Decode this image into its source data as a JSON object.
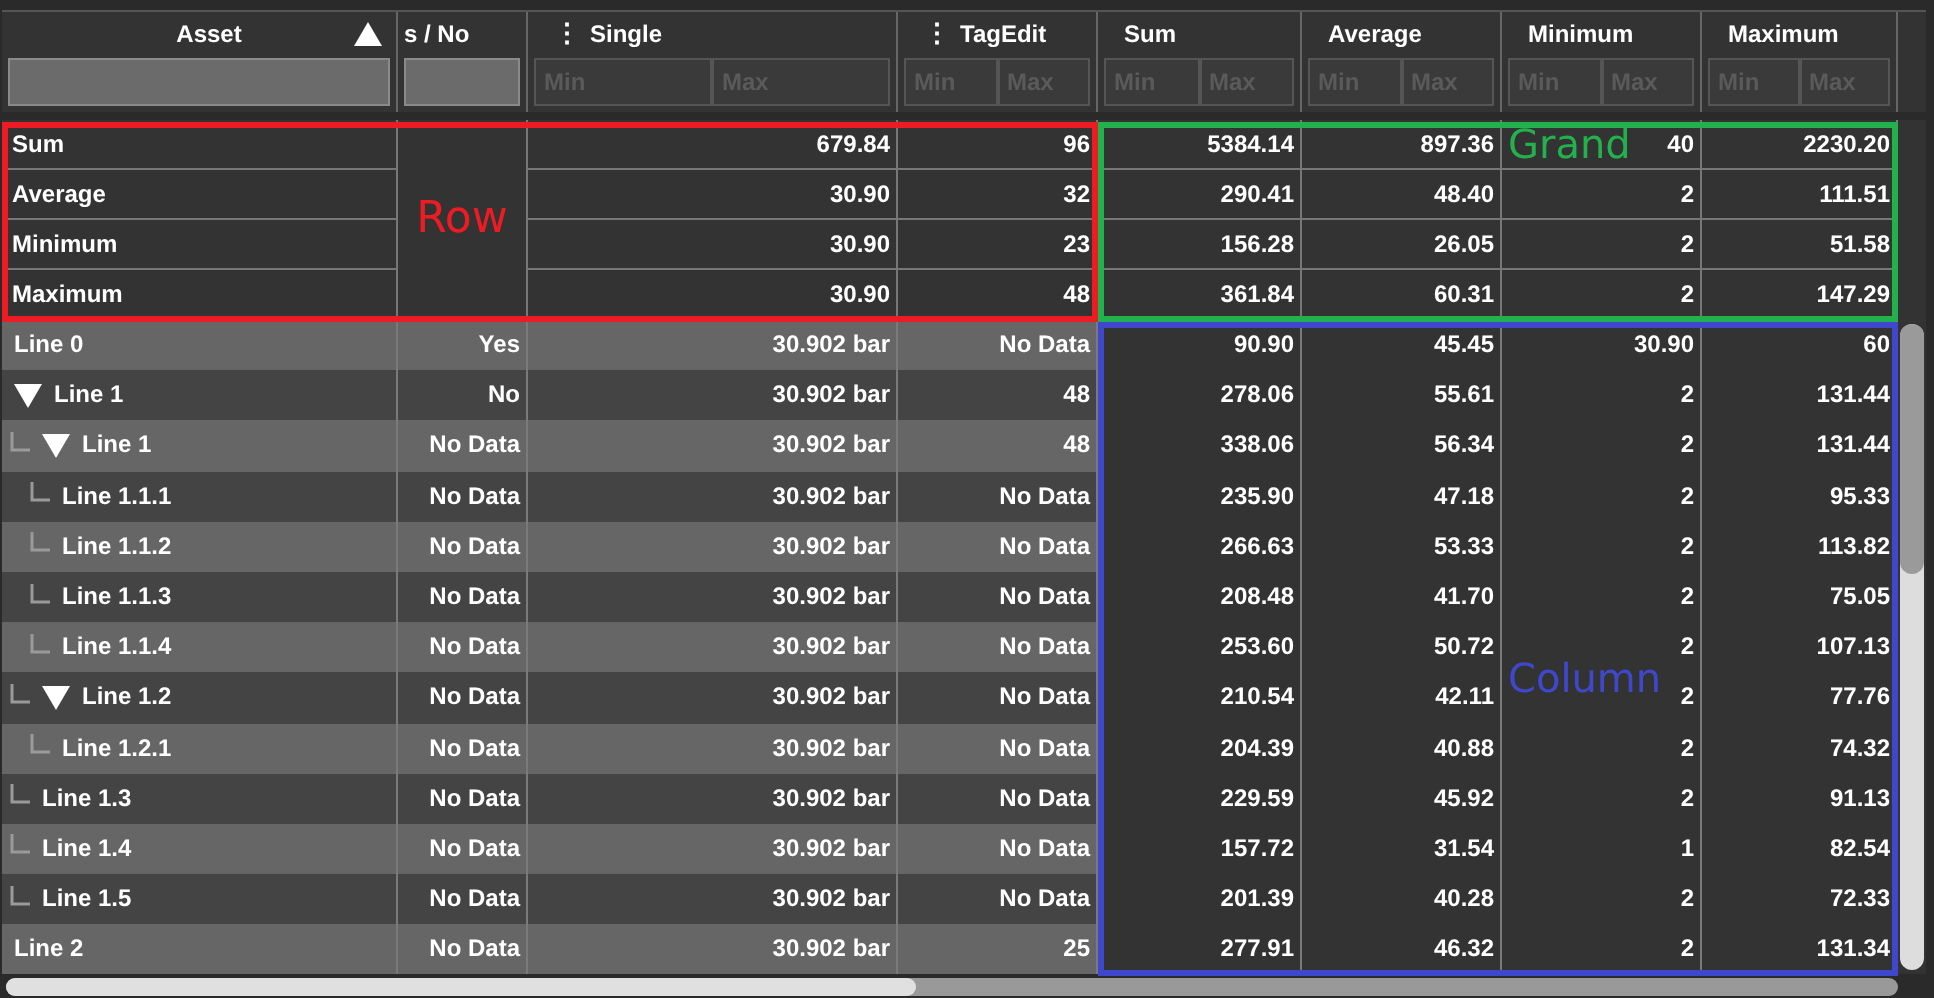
{
  "table": {
    "columns": [
      {
        "title": "Asset",
        "sorted_ascending": true,
        "kind": "text",
        "striped": true
      },
      {
        "title": "s / No",
        "kind": "text",
        "striped": true
      },
      {
        "title": "Single",
        "menu_glyph": "⋮",
        "kind": "range",
        "min_placeholder": "Min",
        "max_placeholder": "Max",
        "striped": true
      },
      {
        "title": "TagEdit",
        "menu_glyph": "⋮",
        "kind": "range",
        "min_placeholder": "Min",
        "max_placeholder": "Max",
        "striped": true
      },
      {
        "title": "Sum",
        "kind": "range",
        "min_placeholder": "Min",
        "max_placeholder": "Max",
        "striped": false
      },
      {
        "title": "Average",
        "kind": "range",
        "min_placeholder": "Min",
        "max_placeholder": "Max",
        "striped": false
      },
      {
        "title": "Minimum",
        "kind": "range",
        "min_placeholder": "Min",
        "max_placeholder": "Max",
        "striped": false
      },
      {
        "title": "Maximum",
        "kind": "range",
        "min_placeholder": "Min",
        "max_placeholder": "Max",
        "striped": false
      }
    ],
    "totals": [
      {
        "label": "Sum",
        "cells": [
          null,
          "679.84",
          "96",
          "5384.14",
          "897.36",
          "40",
          "2230.20"
        ]
      },
      {
        "label": "Average",
        "cells": [
          null,
          "30.90",
          "32",
          "290.41",
          "48.40",
          "2",
          "111.51"
        ]
      },
      {
        "label": "Minimum",
        "cells": [
          null,
          "30.90",
          "23",
          "156.28",
          "26.05",
          "2",
          "51.58"
        ]
      },
      {
        "label": "Maximum",
        "cells": [
          null,
          "30.90",
          "48",
          "361.84",
          "60.31",
          "2",
          "147.29"
        ]
      }
    ],
    "rows": [
      {
        "label": "Line 0",
        "cells": [
          "Yes",
          "30.902 bar",
          "No Data",
          "90.90",
          "45.45",
          "30.90",
          "60"
        ]
      },
      {
        "label": "Line 1",
        "expanded": true,
        "cells": [
          "No",
          "30.902 bar",
          "48",
          "278.06",
          "55.61",
          "2",
          "131.44"
        ],
        "children": [
          {
            "label": "Line 1",
            "expanded": true,
            "cells": [
              "No Data",
              "30.902 bar",
              "48",
              "338.06",
              "56.34",
              "2",
              "131.44"
            ],
            "children": [
              {
                "label": "Line 1.1.1",
                "cells": [
                  "No Data",
                  "30.902 bar",
                  "No Data",
                  "235.90",
                  "47.18",
                  "2",
                  "95.33"
                ]
              },
              {
                "label": "Line 1.1.2",
                "cells": [
                  "No Data",
                  "30.902 bar",
                  "No Data",
                  "266.63",
                  "53.33",
                  "2",
                  "113.82"
                ]
              },
              {
                "label": "Line 1.1.3",
                "cells": [
                  "No Data",
                  "30.902 bar",
                  "No Data",
                  "208.48",
                  "41.70",
                  "2",
                  "75.05"
                ]
              },
              {
                "label": "Line 1.1.4",
                "cells": [
                  "No Data",
                  "30.902 bar",
                  "No Data",
                  "253.60",
                  "50.72",
                  "2",
                  "107.13"
                ]
              }
            ]
          },
          {
            "label": "Line 1.2",
            "expanded": true,
            "cells": [
              "No Data",
              "30.902 bar",
              "No Data",
              "210.54",
              "42.11",
              "2",
              "77.76"
            ],
            "children": [
              {
                "label": "Line 1.2.1",
                "cells": [
                  "No Data",
                  "30.902 bar",
                  "No Data",
                  "204.39",
                  "40.88",
                  "2",
                  "74.32"
                ]
              }
            ]
          },
          {
            "label": "Line 1.3",
            "cells": [
              "No Data",
              "30.902 bar",
              "No Data",
              "229.59",
              "45.92",
              "2",
              "91.13"
            ]
          },
          {
            "label": "Line 1.4",
            "cells": [
              "No Data",
              "30.902 bar",
              "No Data",
              "157.72",
              "31.54",
              "1",
              "82.54"
            ]
          },
          {
            "label": "Line 1.5",
            "cells": [
              "No Data",
              "30.902 bar",
              "No Data",
              "201.39",
              "40.28",
              "2",
              "72.33"
            ]
          }
        ]
      },
      {
        "label": "Line 2",
        "cells": [
          "No Data",
          "30.902 bar",
          "25",
          "277.91",
          "46.32",
          "2",
          "131.34"
        ]
      }
    ]
  },
  "annotations": [
    {
      "kind": "row_totals",
      "label": "Row",
      "color": "#ed1c24"
    },
    {
      "kind": "grand_totals",
      "label": "Grand",
      "color": "#22b14c"
    },
    {
      "kind": "column_values",
      "label": "Column",
      "color": "#3f48cc"
    }
  ]
}
